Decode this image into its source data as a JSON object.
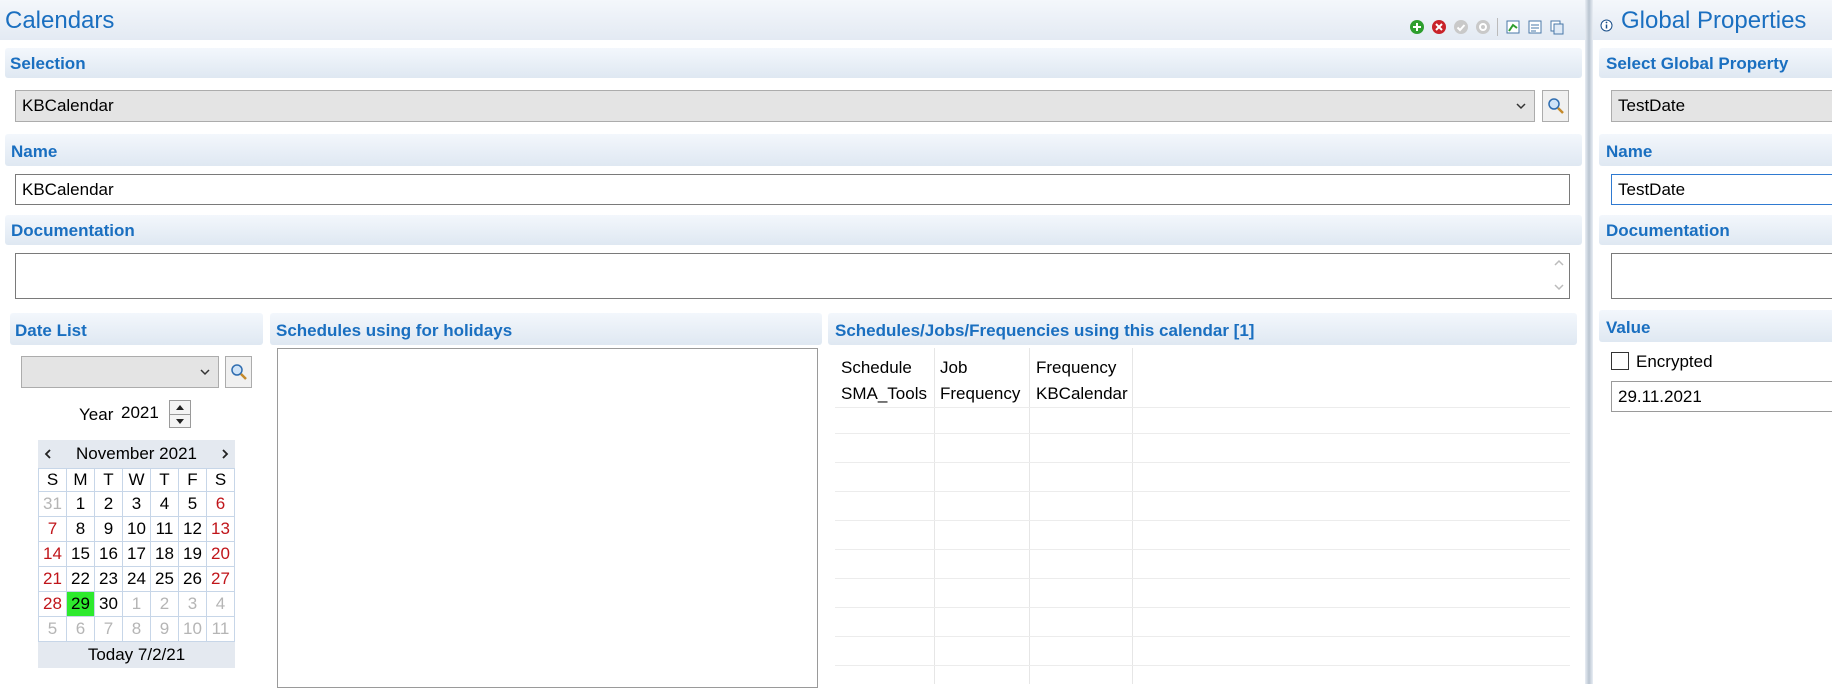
{
  "calendars": {
    "title": "Calendars",
    "toolbar": [
      "add-icon",
      "delete-icon",
      "check-icon",
      "settings-icon",
      "export-icon",
      "report-icon",
      "copy-icon"
    ],
    "selection": {
      "header": "Selection",
      "value": "KBCalendar"
    },
    "name": {
      "header": "Name",
      "value": "KBCalendar"
    },
    "documentation": {
      "header": "Documentation",
      "value": ""
    },
    "date_list": {
      "header": "Date List",
      "combo_value": "",
      "year_label": "Year",
      "year_value": "2021",
      "month_label": "November 2021",
      "weekdays": [
        "S",
        "M",
        "T",
        "W",
        "T",
        "F",
        "S"
      ],
      "weeks": [
        [
          "31",
          "1",
          "2",
          "3",
          "4",
          "5",
          "6"
        ],
        [
          "7",
          "8",
          "9",
          "10",
          "11",
          "12",
          "13"
        ],
        [
          "14",
          "15",
          "16",
          "17",
          "18",
          "19",
          "20"
        ],
        [
          "21",
          "22",
          "23",
          "24",
          "25",
          "26",
          "27"
        ],
        [
          "28",
          "29",
          "30",
          "1",
          "2",
          "3",
          "4"
        ],
        [
          "5",
          "6",
          "7",
          "8",
          "9",
          "10",
          "11"
        ]
      ],
      "selected_day": "29",
      "today": "Today 7/2/21"
    },
    "holidays": {
      "header": "Schedules using for holidays"
    },
    "usage": {
      "header": "Schedules/Jobs/Frequencies using this calendar [1]",
      "columns": [
        "Schedule",
        "Job",
        "Frequency"
      ],
      "rows": [
        [
          "SMA_Tools",
          "Frequency",
          "KBCalendar"
        ]
      ]
    }
  },
  "global_properties": {
    "title": "Global Properties",
    "select": {
      "header": "Select Global Property",
      "value": "TestDate"
    },
    "name": {
      "header": "Name",
      "value": "TestDate"
    },
    "documentation": {
      "header": "Documentation",
      "value": ""
    },
    "value": {
      "header": "Value",
      "encrypted_label": "Encrypted",
      "encrypted": false,
      "text": "29.11.2021"
    }
  }
}
